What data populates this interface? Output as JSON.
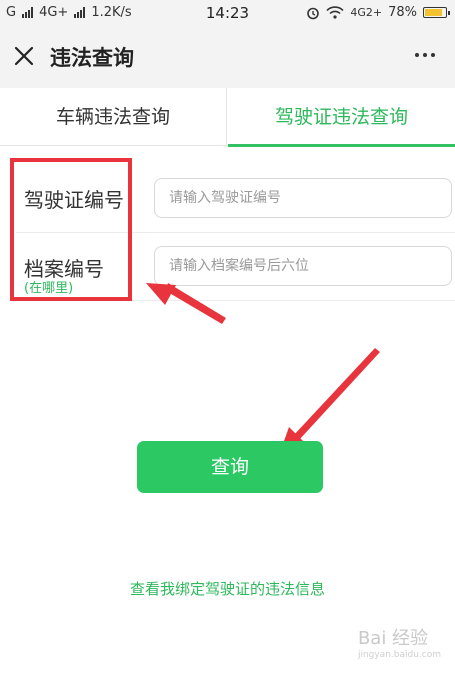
{
  "status_bar": {
    "carrier": "G",
    "network": "4G+",
    "speed": "1.2K/s",
    "time": "14:23",
    "network_right": "4G2+",
    "battery": "78%",
    "battery_level": 0.78
  },
  "nav": {
    "title": "违法查询",
    "close_icon": "close-icon",
    "more_icon": "more-icon"
  },
  "tabs": [
    {
      "label": "车辆违法查询",
      "active": false
    },
    {
      "label": "驾驶证违法查询",
      "active": true
    }
  ],
  "form": {
    "license_label": "驾驶证编号",
    "license_placeholder": "请输入驾驶证编号",
    "file_label": "档案编号",
    "file_placeholder": "请输入档案编号后六位",
    "where_link": "(在哪里)"
  },
  "query_button": "查询",
  "bottom_link": "查看我绑定驾驶证的违法信息",
  "watermark": "Bai 经验",
  "watermark_sub": "jingyan.baidu.com",
  "colors": {
    "accent": "#2bc864",
    "annotation_red": "#e8343c"
  }
}
